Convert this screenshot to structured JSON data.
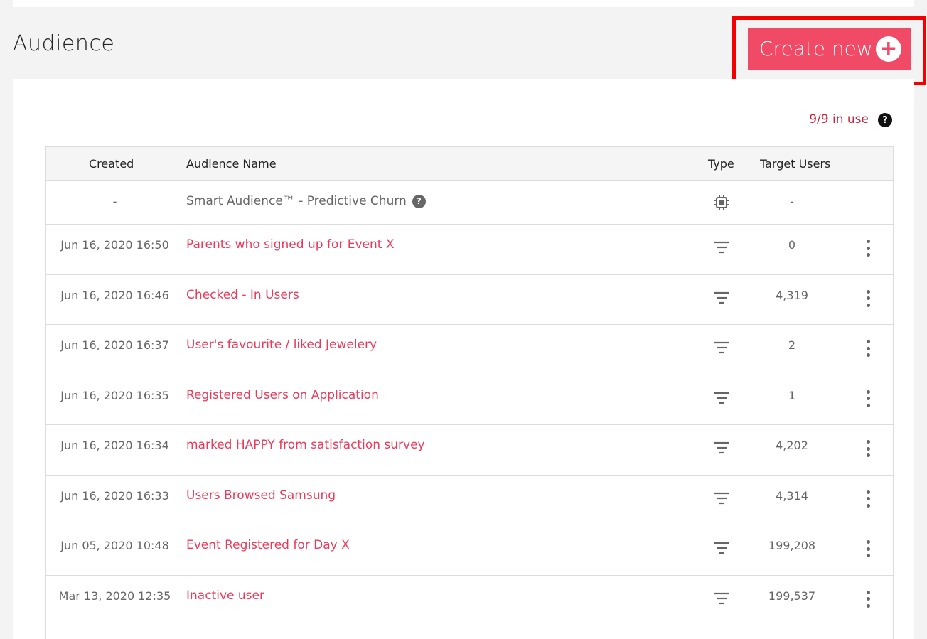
{
  "page": {
    "title": "Audience"
  },
  "toolbar": {
    "create_label": "Create new",
    "create_icon": "plus-circle-icon"
  },
  "usage": {
    "text": "9/9 in use",
    "help_glyph": "?"
  },
  "table": {
    "headers": {
      "created": "Created",
      "name": "Audience Name",
      "type": "Type",
      "target": "Target Users"
    },
    "smart_row": {
      "created": "-",
      "name": "Smart Audience™ - Predictive Churn",
      "help_glyph": "?",
      "type_icon": "chip-icon",
      "target": "-"
    },
    "rows": [
      {
        "created": "Jun 16, 2020 16:50",
        "name": "Parents who signed up for Event X",
        "target": "0",
        "type_icon": "filter-icon"
      },
      {
        "created": "Jun 16, 2020 16:46",
        "name": "Checked - In Users",
        "target": "4,319",
        "type_icon": "filter-icon"
      },
      {
        "created": "Jun 16, 2020 16:37",
        "name": "User's favourite / liked Jewelery",
        "target": "2",
        "type_icon": "filter-icon"
      },
      {
        "created": "Jun 16, 2020 16:35",
        "name": "Registered Users on Application",
        "target": "1",
        "type_icon": "filter-icon"
      },
      {
        "created": "Jun 16, 2020 16:34",
        "name": "marked HAPPY from satisfaction survey",
        "target": "4,202",
        "type_icon": "filter-icon"
      },
      {
        "created": "Jun 16, 2020 16:33",
        "name": "Users Browsed Samsung",
        "target": "4,314",
        "type_icon": "filter-icon"
      },
      {
        "created": "Jun 05, 2020 10:48",
        "name": "Event Registered for Day X",
        "target": "199,208",
        "type_icon": "filter-icon"
      },
      {
        "created": "Mar 13, 2020 12:35",
        "name": "Inactive user",
        "target": "199,537",
        "type_icon": "filter-icon"
      }
    ]
  },
  "colors": {
    "accent": "#f04a66",
    "link": "#ea3a5a",
    "usage": "#c8253f",
    "highlight": "#f50000"
  }
}
